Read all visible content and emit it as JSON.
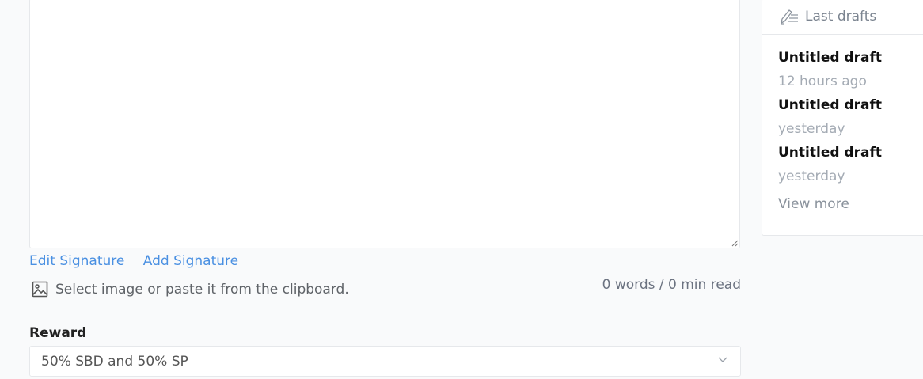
{
  "editor": {
    "value": ""
  },
  "signature": {
    "edit_label": "Edit Signature",
    "add_label": "Add Signature"
  },
  "image_upload": {
    "icon": "image-icon",
    "label": "Select image or paste it from the clipboard."
  },
  "word_count": "0 words / 0 min read",
  "reward": {
    "label": "Reward",
    "selected": "50% SBD and 50% SP"
  },
  "drafts": {
    "header_icon": "pen-icon",
    "header": "Last drafts",
    "items": [
      {
        "title": "Untitled draft",
        "time": "12 hours ago"
      },
      {
        "title": "Untitled draft",
        "time": "yesterday"
      },
      {
        "title": "Untitled draft",
        "time": "yesterday"
      }
    ],
    "view_more": "View more"
  },
  "colors": {
    "link": "#4a90e2",
    "background": "#f9fafb",
    "border": "#e6e8eb"
  }
}
